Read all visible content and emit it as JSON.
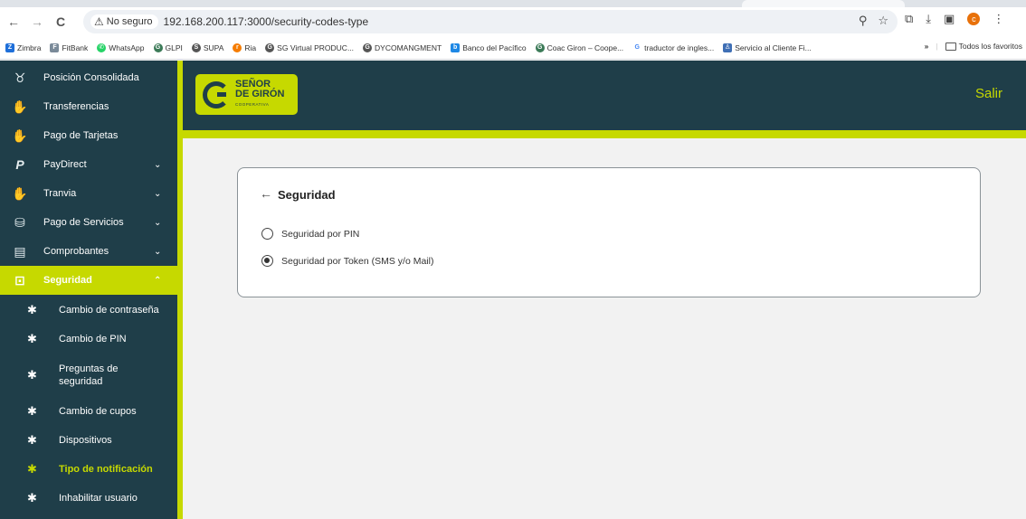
{
  "browser": {
    "nav": {
      "back": "←",
      "forward": "→",
      "reload": "C"
    },
    "security_badge": "No seguro",
    "url": "192.168.200.117:3000/security-codes-type",
    "omnibox_icons": [
      "zoom-icon",
      "star-icon"
    ],
    "toolbar_icons": [
      "extensions-icon",
      "download-icon",
      "sidepanel-icon",
      "profile-icon",
      "menu-icon"
    ],
    "profile_initial": "c",
    "bookmarks": [
      {
        "label": "Zimbra",
        "icon": "zimbra-icon",
        "color": "#1e6fd9"
      },
      {
        "label": "FitBank",
        "icon": "fitbank-icon",
        "color": "#7a8a99"
      },
      {
        "label": "WhatsApp",
        "icon": "whatsapp-icon",
        "color": "#25d366"
      },
      {
        "label": "GLPI",
        "icon": "g-icon",
        "color": "#3b7a57"
      },
      {
        "label": "SUPA",
        "icon": "supa-icon",
        "color": "#555555"
      },
      {
        "label": "Ria",
        "icon": "ria-icon",
        "color": "#f57c00"
      },
      {
        "label": "SG Virtual PRODUC...",
        "icon": "sg-icon",
        "color": "#555555"
      },
      {
        "label": "DYCOMANGMENT",
        "icon": "dyco-icon",
        "color": "#555555"
      },
      {
        "label": "Banco del Pacífico",
        "icon": "bank-icon",
        "color": "#1e88e5"
      },
      {
        "label": "Coac Giron – Coope...",
        "icon": "coac-icon",
        "color": "#3b7a57"
      },
      {
        "label": "traductor de ingles...",
        "icon": "google-icon",
        "color": "#4285f4"
      },
      {
        "label": "Servicio al Cliente Fi...",
        "icon": "person-icon",
        "color": "#3f6fb5"
      }
    ],
    "bookmarks_overflow": "»",
    "all_bookmarks": "Todos los favoritos"
  },
  "sidebar": {
    "items": [
      {
        "label": "Posición Consolidada",
        "icon": "piggy-bank-icon",
        "chevron": ""
      },
      {
        "label": "Transferencias",
        "icon": "money-hand-icon",
        "chevron": ""
      },
      {
        "label": "Pago de Tarjetas",
        "icon": "money-hand-icon",
        "chevron": ""
      },
      {
        "label": "PayDirect",
        "icon": "paydirect-icon",
        "chevron": "⌄"
      },
      {
        "label": "Tranvia",
        "icon": "money-hand-icon",
        "chevron": "⌄"
      },
      {
        "label": "Pago de Servicios",
        "icon": "coins-icon",
        "chevron": "⌄"
      },
      {
        "label": "Comprobantes",
        "icon": "receipt-icon",
        "chevron": "⌄"
      },
      {
        "label": "Seguridad",
        "icon": "safe-icon",
        "chevron": "⌃"
      }
    ],
    "subitems": [
      {
        "label": "Cambio de contraseña"
      },
      {
        "label": "Cambio de PIN"
      },
      {
        "label": "Preguntas de seguridad"
      },
      {
        "label": "Cambio de cupos"
      },
      {
        "label": "Dispositivos"
      },
      {
        "label": "Tipo de notificación"
      },
      {
        "label": "Inhabilitar usuario"
      }
    ]
  },
  "header": {
    "logo_line1": "SEÑOR",
    "logo_line2": "DE GIRÓN",
    "logo_line3": "COOPERATIVA",
    "logout": "Salir"
  },
  "card": {
    "back_glyph": "←",
    "title": "Seguridad",
    "options": [
      {
        "label": "Seguridad por PIN",
        "selected": false
      },
      {
        "label": "Seguridad por Token (SMS y/o Mail)",
        "selected": true
      }
    ]
  },
  "colors": {
    "brand_dark": "#1f3e49",
    "brand_accent": "#c6d900"
  }
}
